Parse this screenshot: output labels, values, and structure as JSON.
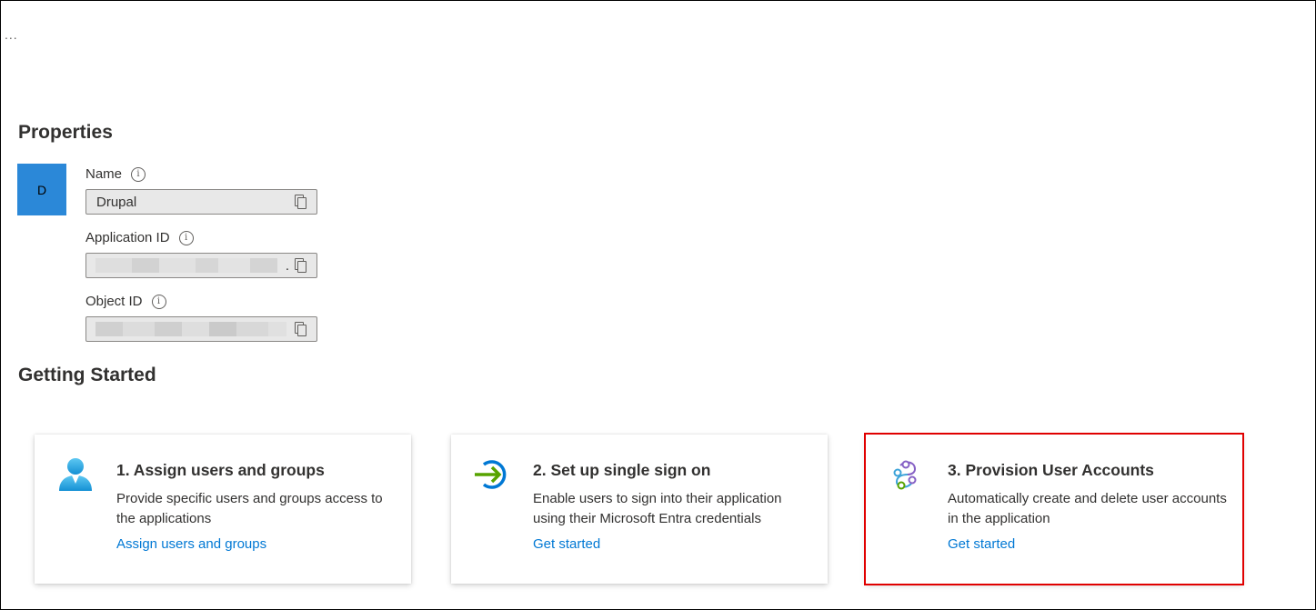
{
  "header": {
    "more_label": "..."
  },
  "properties": {
    "heading": "Properties",
    "avatar_letter": "D",
    "name_label": "Name",
    "name_value": "Drupal",
    "app_id_label": "Application ID",
    "app_id_suffix": ".",
    "object_id_label": "Object ID"
  },
  "getting_started": {
    "heading": "Getting Started",
    "cards": [
      {
        "title": "1. Assign users and groups",
        "description": "Provide specific users and groups access to the applications",
        "link": "Assign users and groups",
        "icon": "user-icon"
      },
      {
        "title": "2. Set up single sign on",
        "description": "Enable users to sign into their application using their Microsoft Entra credentials",
        "link": "Get started",
        "icon": "sign-in-arrow-icon"
      },
      {
        "title": "3. Provision User Accounts",
        "description": "Automatically create and delete user accounts in the application",
        "link": "Get started",
        "icon": "provisioning-icon"
      }
    ]
  },
  "colors": {
    "accent": "#0078d4",
    "avatar": "#2b88d8",
    "highlight": "#e00000"
  }
}
